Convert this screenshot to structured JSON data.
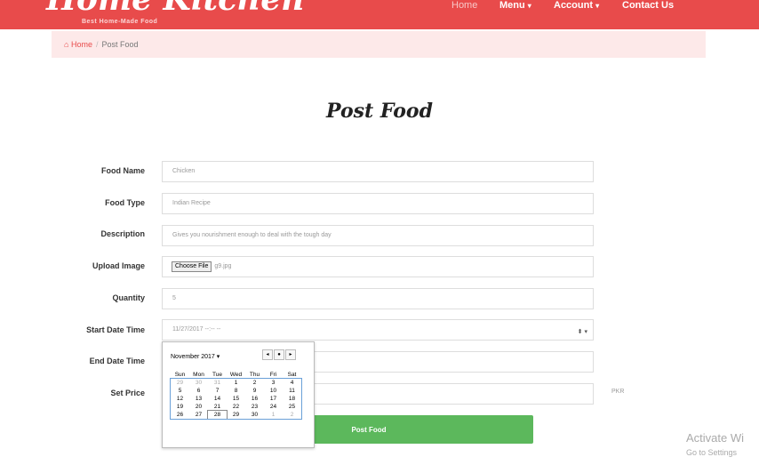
{
  "header": {
    "logo": "Home Kitchen",
    "tagline": "Best Home-Made Food",
    "nav": [
      {
        "label": "Home"
      },
      {
        "label": "Menu",
        "caret": "▾"
      },
      {
        "label": "Account",
        "caret": "▾"
      },
      {
        "label": "Contact Us"
      }
    ]
  },
  "breadcrumb": {
    "home": "Home",
    "separator": "/",
    "current": "Post Food"
  },
  "page_title": "Post Food",
  "form": {
    "food_name": {
      "label": "Food Name",
      "value": "Chicken"
    },
    "food_type": {
      "label": "Food Type",
      "value": "Indian Recipe"
    },
    "description": {
      "label": "Description",
      "value": "Gives you nourishment enough to deal with the tough day"
    },
    "upload_image": {
      "label": "Upload Image",
      "button": "Choose File",
      "file": "g9.jpg"
    },
    "quantity": {
      "label": "Quantity",
      "value": "5"
    },
    "start_date_time": {
      "label": "Start Date Time",
      "value": "11/27/2017 --:-- --"
    },
    "end_date_time": {
      "label": "End Date Time"
    },
    "set_price": {
      "label": "Set Price",
      "unit": "PKR"
    },
    "submit": "Post Food"
  },
  "calendar": {
    "month": "November 2017",
    "weekdays": [
      "Sun",
      "Mon",
      "Tue",
      "Wed",
      "Thu",
      "Fri",
      "Sat"
    ],
    "weeks": [
      [
        "29",
        "30",
        "31",
        "1",
        "2",
        "3",
        "4"
      ],
      [
        "5",
        "6",
        "7",
        "8",
        "9",
        "10",
        "11"
      ],
      [
        "12",
        "13",
        "14",
        "15",
        "16",
        "17",
        "18"
      ],
      [
        "19",
        "20",
        "21",
        "22",
        "23",
        "24",
        "25"
      ],
      [
        "26",
        "27",
        "28",
        "29",
        "30",
        "1",
        "2"
      ]
    ],
    "selected": "28"
  },
  "watermark": {
    "line1": "Activate Wi",
    "line2": "Go to Settings"
  },
  "colors": {
    "brand": "#e84b4b",
    "submit": "#5cb85c"
  }
}
